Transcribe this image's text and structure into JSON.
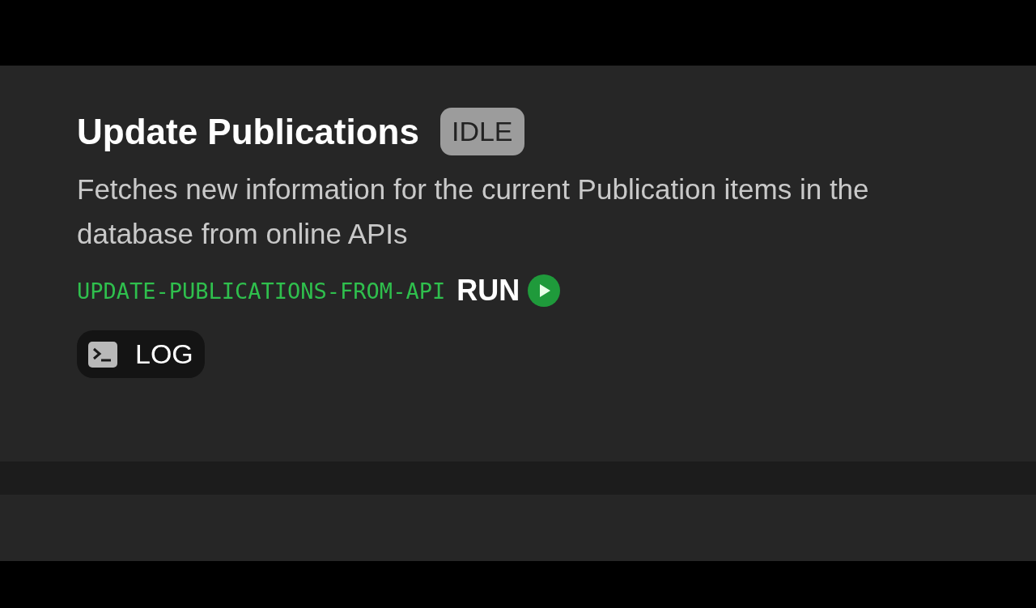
{
  "task": {
    "title": "Update Publications",
    "status": "IDLE",
    "description": "Fetches new information for the current Publication items in the database from online APIs",
    "command": "UPDATE-PUBLICATIONS-FROM-API",
    "run_button": {
      "label": "RUN"
    },
    "log_button": {
      "label": "LOG"
    }
  }
}
